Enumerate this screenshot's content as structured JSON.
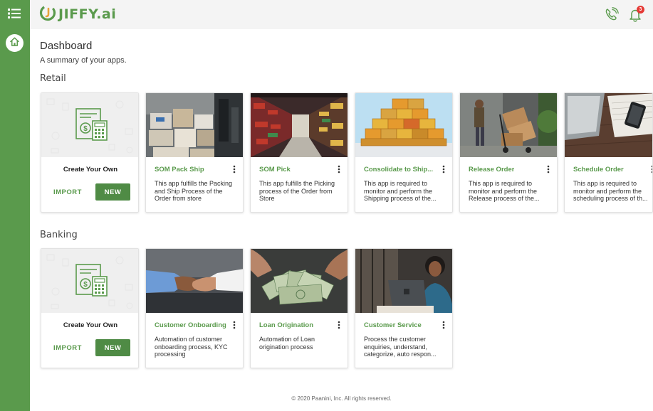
{
  "app": {
    "logo_text": "JIFFY.ai",
    "notification_count": "3"
  },
  "dashboard": {
    "title": "Dashboard",
    "subtitle": "A summary of your apps."
  },
  "sections": {
    "retail": {
      "title": "Retail",
      "create": {
        "label": "Create Your Own",
        "import_label": "IMPORT",
        "new_label": "NEW"
      },
      "apps": [
        {
          "title": "SOM Pack Ship",
          "desc": "This app fulfills the Packing and Ship Process of the Order from store",
          "image": "boxes-shelves"
        },
        {
          "title": "SOM Pick",
          "desc": "This app fulfills the Picking process of the Order from Store",
          "image": "store-aisle"
        },
        {
          "title": "Consolidate to Ship...",
          "desc": "This app is required to monitor and perform the Shipping process of the...",
          "image": "shipping-containers"
        },
        {
          "title": "Release Order",
          "desc": "This app is required to monitor and perform the Release process of the...",
          "image": "delivery-cart"
        },
        {
          "title": "Schedule Order",
          "desc": "This app is required to monitor and perform the scheduling process of th...",
          "image": "laptop-desk"
        }
      ]
    },
    "banking": {
      "title": "Banking",
      "create": {
        "label": "Create Your Own",
        "import_label": "IMPORT",
        "new_label": "NEW"
      },
      "apps": [
        {
          "title": "Customer Onboarding",
          "desc": "Automation of customer onboarding process, KYC processing",
          "image": "handshake"
        },
        {
          "title": "Loan Origination",
          "desc": "Automation of Loan origination process",
          "image": "cash-fan"
        },
        {
          "title": "Customer Service",
          "desc": "Process the customer enquiries, understand, categorize, auto respon...",
          "image": "service-agent"
        }
      ]
    }
  },
  "footer": {
    "copyright": "© 2020 Paanini, Inc. All rights reserved."
  },
  "colors": {
    "brand_green": "#5a9a4c",
    "button_green": "#4f8b45",
    "badge_red": "#e53935"
  }
}
